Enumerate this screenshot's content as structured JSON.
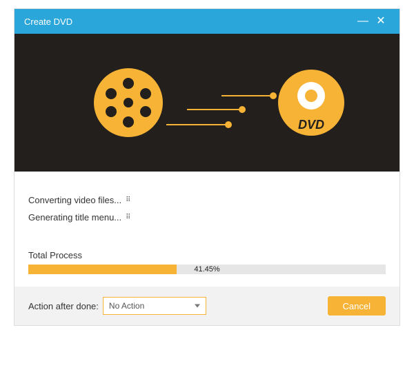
{
  "window": {
    "title": "Create DVD"
  },
  "status": {
    "line1": "Converting video files...",
    "line2": "Generating title menu..."
  },
  "progress": {
    "label": "Total Process",
    "percent": 41.45,
    "percent_text": "41.45%"
  },
  "footer": {
    "action_label": "Action after done:",
    "action_selected": "No Action",
    "cancel_label": "Cancel"
  },
  "colors": {
    "accent": "#f6b336",
    "titlebar": "#2aa6da",
    "hero_bg": "#231f1c"
  },
  "icons": {
    "minimize": "—",
    "close": "✕"
  }
}
